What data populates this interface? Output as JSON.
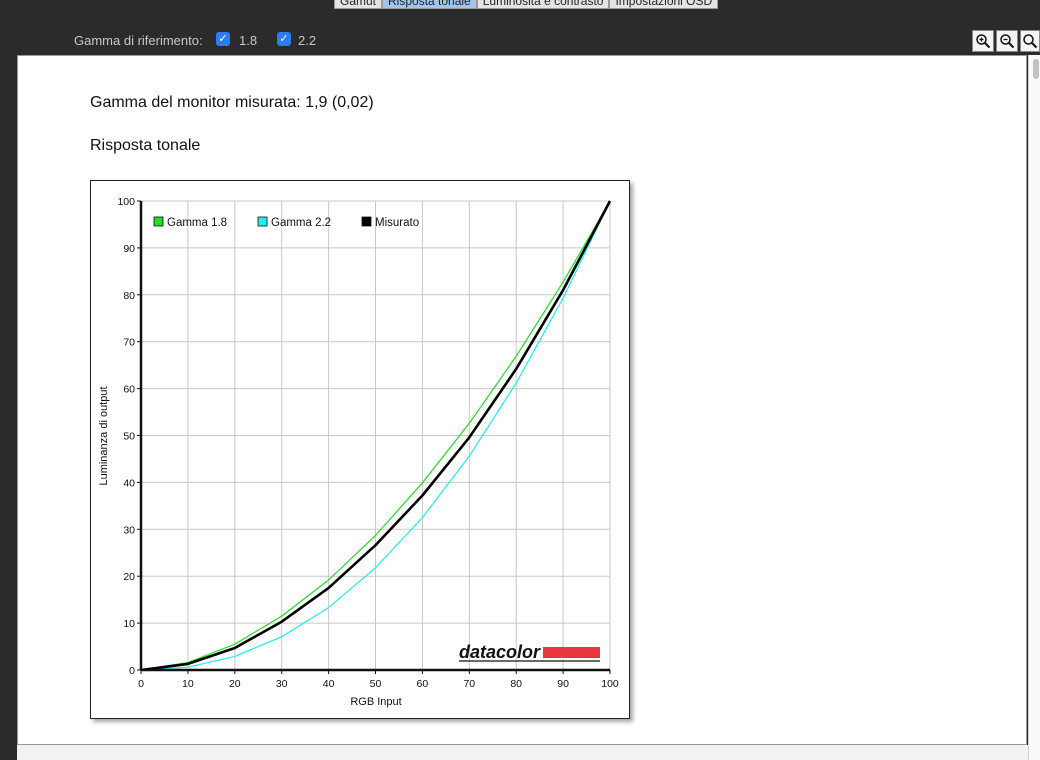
{
  "tabs": [
    {
      "label": "Gamut",
      "active": false
    },
    {
      "label": "Risposta tonale",
      "active": true
    },
    {
      "label": "Luminosità e contrasto",
      "active": false
    },
    {
      "label": "Impostazioni OSD",
      "active": false
    }
  ],
  "toolbar": {
    "reference_label": "Gamma di riferimento:",
    "checkbox_1": {
      "label": "1.8",
      "checked": true
    },
    "checkbox_2": {
      "label": "2.2",
      "checked": true
    },
    "zoom_in_icon": "zoom-in-icon",
    "zoom_out_icon": "zoom-out-icon",
    "zoom_reset_icon": "zoom-fit-icon"
  },
  "content": {
    "measured_gamma": "Gamma del monitor misurata: 1,9 (0,02)",
    "section_title": "Risposta tonale"
  },
  "colors": {
    "gamma18": "#22dd22",
    "gamma22": "#22eeee",
    "measured": "#000000",
    "brand_red": "#e8383d"
  },
  "chart_data": {
    "type": "line",
    "title": "",
    "xlabel": "RGB Input",
    "ylabel": "Luminanza di output",
    "xlim": [
      0,
      100
    ],
    "ylim": [
      0,
      100
    ],
    "xticks": [
      0,
      10,
      20,
      30,
      40,
      50,
      60,
      70,
      80,
      90,
      100
    ],
    "yticks": [
      0,
      10,
      20,
      30,
      40,
      50,
      60,
      70,
      80,
      90,
      100
    ],
    "grid": true,
    "legend_position": "top-left",
    "x": [
      0,
      10,
      20,
      30,
      40,
      50,
      60,
      70,
      80,
      90,
      100
    ],
    "series": [
      {
        "name": "Gamma 1.8",
        "color": "#22dd22",
        "values": [
          0,
          1.6,
          5.5,
          11.5,
          19.2,
          28.7,
          39.9,
          52.6,
          66.9,
          82.7,
          100
        ]
      },
      {
        "name": "Gamma 2.2",
        "color": "#22eeee",
        "values": [
          0,
          0.6,
          2.9,
          7.1,
          13.3,
          21.8,
          32.5,
          45.6,
          61.2,
          79.3,
          100
        ]
      },
      {
        "name": "Misurato",
        "color": "#000000",
        "values": [
          0,
          1.3,
          4.7,
          10.3,
          17.5,
          26.6,
          37.2,
          49.6,
          64.2,
          81.0,
          100
        ]
      }
    ],
    "logo_text": "datacolor"
  }
}
